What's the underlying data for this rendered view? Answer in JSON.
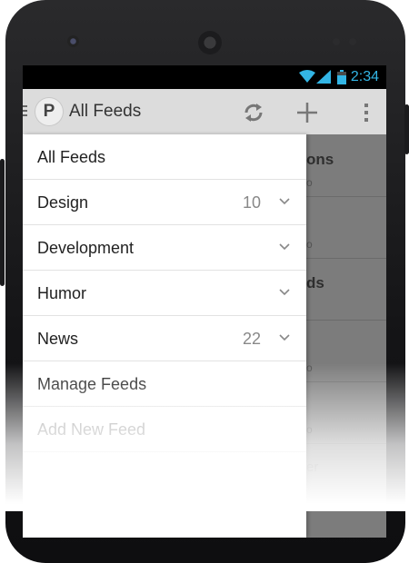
{
  "status_bar": {
    "time": "2:34"
  },
  "action_bar": {
    "logo_letter": "P",
    "title": "All Feeds"
  },
  "drawer": {
    "items": [
      {
        "label": "All Feeds",
        "count": "",
        "expandable": false
      },
      {
        "label": "Design",
        "count": "10",
        "expandable": true
      },
      {
        "label": "Development",
        "count": "",
        "expandable": true
      },
      {
        "label": "Humor",
        "count": "",
        "expandable": true
      },
      {
        "label": "News",
        "count": "22",
        "expandable": true
      },
      {
        "label": "Manage Feeds",
        "count": "",
        "expandable": false
      },
      {
        "label": "Add New Feed",
        "count": "",
        "expandable": false
      }
    ]
  },
  "background_content": {
    "rows": [
      {
        "title": "ons",
        "sub": "o"
      },
      {
        "title": "",
        "sub": "o"
      },
      {
        "title": "ds",
        "sub": ""
      },
      {
        "title": "",
        "sub": "o"
      },
      {
        "title": "",
        "sub": "o"
      },
      {
        "title": "",
        "sub": "er"
      }
    ]
  },
  "colors": {
    "accent": "#33b5e5",
    "action_bar": "#dcdcdc",
    "drawer": "#ffffff"
  },
  "icons": [
    "wifi-icon",
    "signal-icon",
    "battery-icon",
    "refresh-icon",
    "add-icon",
    "overflow-icon",
    "chevron-down-icon"
  ]
}
